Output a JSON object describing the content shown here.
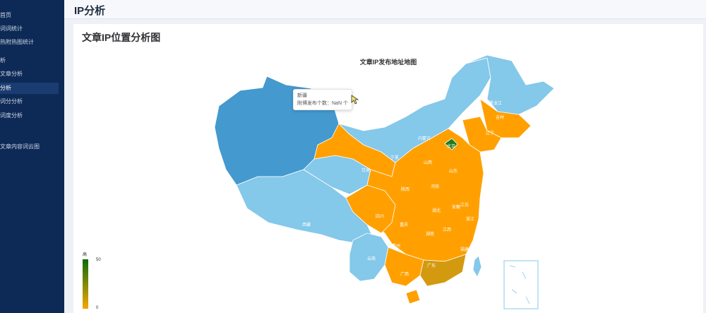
{
  "sidebar": {
    "items": [
      {
        "label": "首页",
        "active": false
      },
      {
        "label": "词词统计",
        "active": false
      },
      {
        "label": "热附热图统计",
        "active": false
      },
      {
        "label": "析",
        "active": false
      },
      {
        "label": "文章分析",
        "active": false
      },
      {
        "label": "分析",
        "active": true
      },
      {
        "label": "词分分析",
        "active": false
      },
      {
        "label": "词度分析",
        "active": false
      },
      {
        "label": "文章内容词云图",
        "active": false
      }
    ]
  },
  "header": {
    "title": "IP分析"
  },
  "card": {
    "title": "文章IP位置分析图"
  },
  "chart_data": {
    "type": "map",
    "title": "文章IP发布地址地图",
    "visual_map": {
      "min": 0,
      "max": 50,
      "high_label": "高",
      "min_label": "0",
      "max_label": "50",
      "colors": [
        "#f6a700",
        "#0b6b0b"
      ]
    },
    "regions": [
      {
        "name": "新疆",
        "fill": "#4499cf"
      },
      {
        "name": "西藏",
        "fill": "#84c8ea"
      },
      {
        "name": "青海",
        "fill": "#84c8ea"
      },
      {
        "name": "甘肃",
        "fill": "#ffa000"
      },
      {
        "name": "内蒙古",
        "fill": "#84c8ea"
      },
      {
        "name": "黑龙江",
        "fill": "#84c8ea"
      },
      {
        "name": "吉林",
        "fill": "#ffa000"
      },
      {
        "name": "辽宁",
        "fill": "#ffa000"
      },
      {
        "name": "北京",
        "fill": "#1f7a1f"
      },
      {
        "name": "四川",
        "fill": "#ffa000"
      },
      {
        "name": "云南",
        "fill": "#84c8ea"
      },
      {
        "name": "广东",
        "fill": "#d39a10"
      },
      {
        "name": "广西",
        "fill": "#ffa000"
      },
      {
        "name": "海南",
        "fill": "#ffa000"
      },
      {
        "name": "台湾",
        "fill": "#84c8ea"
      }
    ],
    "tooltip": {
      "region": "新疆",
      "line": "附博发布个数：NaN 个"
    },
    "labels": [
      "黑龙江",
      "吉林",
      "辽宁",
      "内蒙古",
      "北京",
      "山西",
      "山东",
      "陕西",
      "河南",
      "甘肃",
      "宁夏",
      "四川",
      "重庆",
      "湖北",
      "安徽",
      "江苏",
      "贵州",
      "湖南",
      "江西",
      "浙江",
      "福建",
      "云南",
      "广西",
      "广东",
      "西藏"
    ]
  },
  "colors": {
    "sidebar": "#0d2a57",
    "accent": "#ffa000",
    "light_blue": "#84c8ea",
    "mid_blue": "#4499cf",
    "green": "#1f7a1f"
  }
}
